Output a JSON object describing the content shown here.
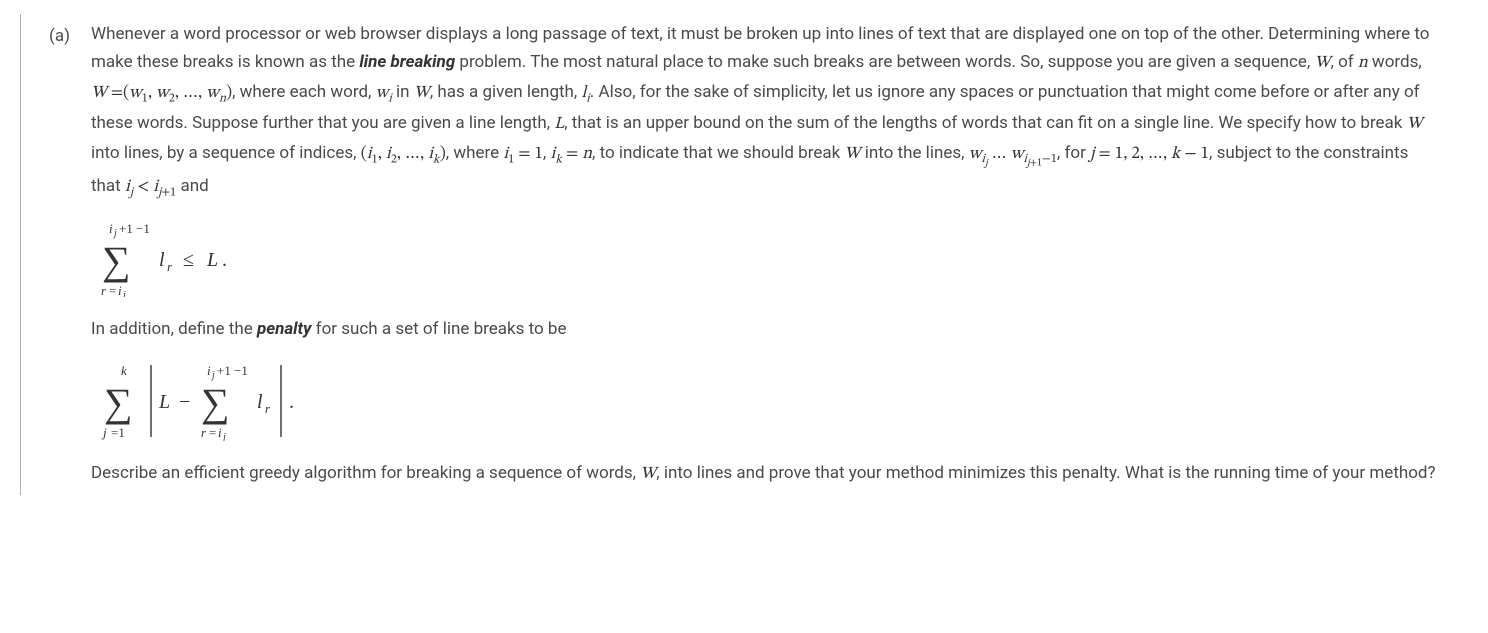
{
  "problem": {
    "label": "(a)",
    "para1_a": "Whenever a word processor or web browser displays a long passage of text, it must be broken up into lines of text that are displayed one on top of the other. Determining where to make these breaks is known as the ",
    "term_linebreaking": "line breaking",
    "para1_b": " problem. The most natural place to make such breaks are between words. So, suppose you are given a sequence, ",
    "m_W1": "W",
    "para1_c": ", of ",
    "m_n1": "n",
    "para1_d": " words, ",
    "m_Wdef": "W =(w₁, w₂, …, wₙ)",
    "para1_e": ", where each word, ",
    "m_wi": "wᵢ",
    "para1_f": " in ",
    "m_W2": "W",
    "para1_g": ", has a given length, ",
    "m_li": "lᵢ",
    "para1_h": ". Also, for the sake of simplicity, let us ignore any spaces or punctuation that might come before or after any of these words. Suppose further that you are given a line length, ",
    "m_L": "L",
    "para1_i": ", that is an upper bound on the sum of the lengths of words that can fit on a single line. We specify how to break ",
    "m_W3": "W",
    "para1_j": " into lines, by a sequence of indices, ",
    "m_idx": "(i₁, i₂, …, iₖ)",
    "para1_k": ", where ",
    "m_i1eq": "i₁ = 1",
    "para1_l": ", ",
    "m_ikeq": "iₖ = n",
    "para1_m": ", to indicate that we should break ",
    "m_W4": "W",
    "para1_n": " into the lines, ",
    "m_wline": "w_{i_j} … w_{i_{j+1}−1}",
    "para1_o": ", for ",
    "m_jrange": "j = 1, 2, …, k − 1",
    "para1_p": ", subject to the constraints that ",
    "m_constraint": "iⱼ < i_{j+1}",
    "para1_q": " and",
    "para2_a": "In addition, define the ",
    "term_penalty": "penalty",
    "para2_b": " for such a set of line breaks to be",
    "para3_a": "Describe an efficient greedy algorithm for breaking a sequence of words, ",
    "m_W5": "W",
    "para3_b": ", into lines and prove that your method minimizes this penalty. What is the running time of your method?",
    "formula1": {
      "lower": "r=i_j",
      "upper": "i_{j+1}−1",
      "body": "l_r ≤ L."
    },
    "formula2": {
      "outer_lower": "j=1",
      "outer_upper": "k",
      "inner_lower": "r=i_j",
      "inner_upper": "i_{j+1}−1",
      "body_left": "L −",
      "body_right": "l_r",
      "tail": "."
    }
  }
}
